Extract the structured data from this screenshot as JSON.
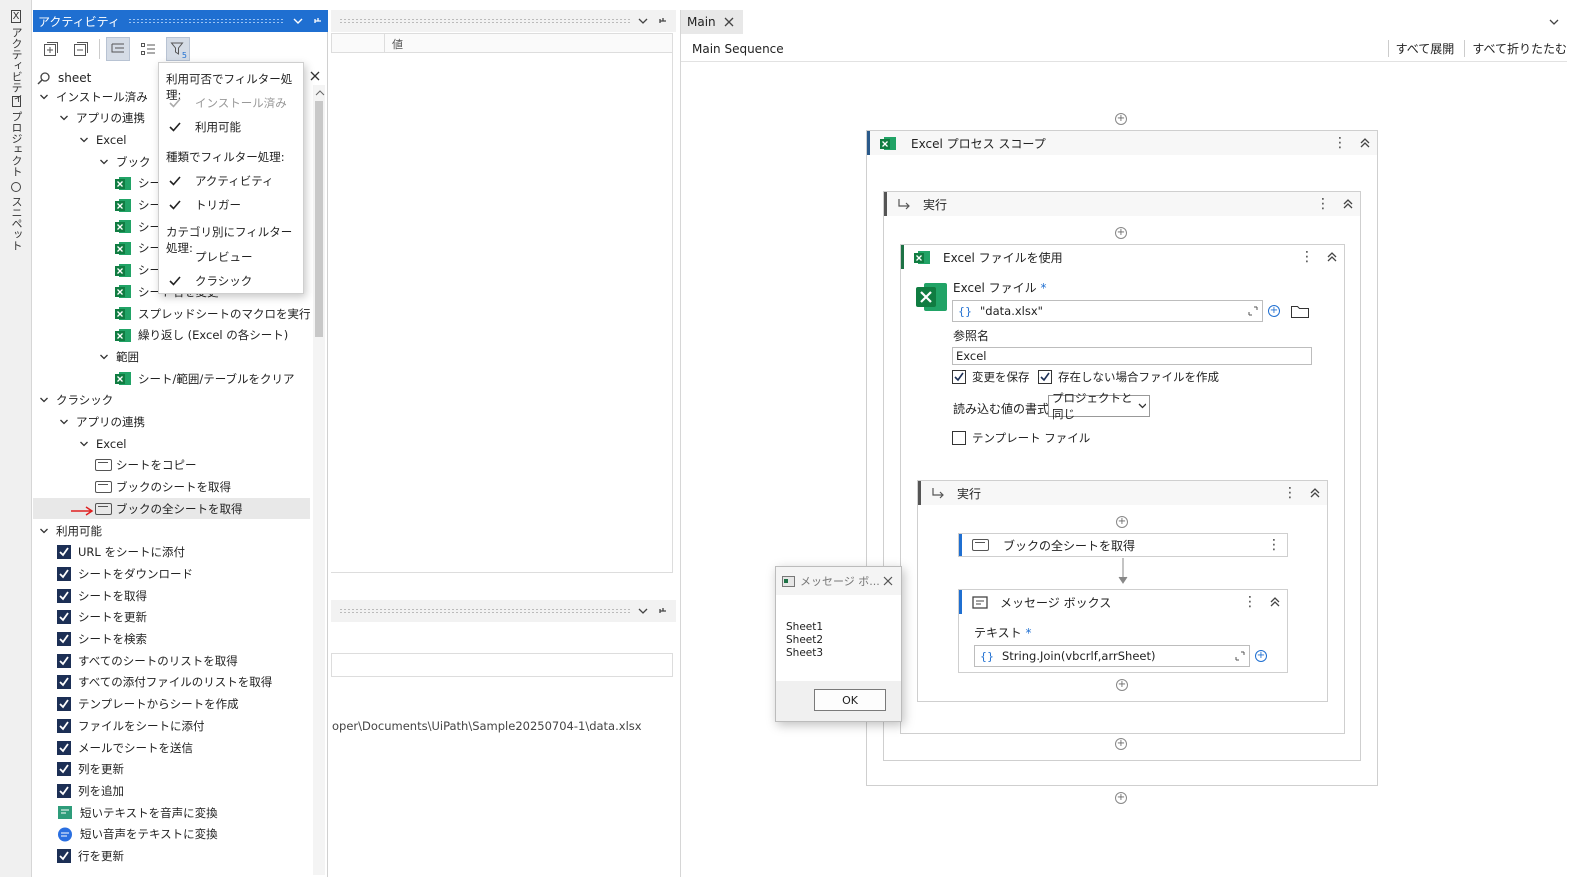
{
  "strip": {
    "tabs": [
      "アクティビティ",
      "プロジェクト",
      "スニペット"
    ]
  },
  "activities": {
    "title": "アクティビティ",
    "search_value": "sheet",
    "tree": [
      {
        "label": "インストール済み",
        "kind": "group"
      },
      {
        "label": "アプリの連携",
        "kind": "group"
      },
      {
        "label": "Excel",
        "kind": "group"
      },
      {
        "label": "ブック",
        "kind": "group"
      },
      {
        "label": "シートを…",
        "kind": "excel"
      },
      {
        "label": "シート…",
        "kind": "excel"
      },
      {
        "label": "シート…",
        "kind": "excel"
      },
      {
        "label": "シート…",
        "kind": "excel"
      },
      {
        "label": "シート…",
        "kind": "excel"
      },
      {
        "label": "シート名を変更",
        "kind": "excel"
      },
      {
        "label": "スプレッドシートのマクロを実行",
        "kind": "excel"
      },
      {
        "label": "繰り返し (Excel の各シート)",
        "kind": "excel"
      },
      {
        "label": "範囲",
        "kind": "group"
      },
      {
        "label": "シート/範囲/テーブルをクリア",
        "kind": "excel"
      },
      {
        "label": "クラシック",
        "kind": "group"
      },
      {
        "label": "アプリの連携",
        "kind": "group"
      },
      {
        "label": "Excel",
        "kind": "group"
      },
      {
        "label": "シートをコピー",
        "kind": "classic"
      },
      {
        "label": "ブックのシートを取得",
        "kind": "classic"
      },
      {
        "label": "ブックの全シートを取得",
        "kind": "classic"
      },
      {
        "label": "利用可能",
        "kind": "group"
      },
      {
        "label": "URL をシートに添付",
        "kind": "avail"
      },
      {
        "label": "シートをダウンロード",
        "kind": "avail"
      },
      {
        "label": "シートを取得",
        "kind": "avail"
      },
      {
        "label": "シートを更新",
        "kind": "avail"
      },
      {
        "label": "シートを検索",
        "kind": "avail"
      },
      {
        "label": "すべてのシートのリストを取得",
        "kind": "avail"
      },
      {
        "label": "すべての添付ファイルのリストを取得",
        "kind": "avail"
      },
      {
        "label": "テンプレートからシートを作成",
        "kind": "avail"
      },
      {
        "label": "ファイルをシートに添付",
        "kind": "avail"
      },
      {
        "label": "メールでシートを送信",
        "kind": "avail"
      },
      {
        "label": "列を更新",
        "kind": "avail"
      },
      {
        "label": "列を追加",
        "kind": "avail"
      },
      {
        "label": "短いテキストを音声に変換",
        "kind": "tts"
      },
      {
        "label": "短い音声をテキストに変換",
        "kind": "stt"
      },
      {
        "label": "行を更新",
        "kind": "avail"
      }
    ]
  },
  "filter_popup": {
    "header_availability": "利用可否でフィルター処理:",
    "installed": "インストール済み",
    "available": "利用可能",
    "header_type": "種類でフィルター処理:",
    "activity": "アクティビティ",
    "trigger": "トリガー",
    "header_category": "カテゴリ別にフィルター処理:",
    "preview": "プレビュー",
    "classic": "クラシック",
    "filter_badge": "5"
  },
  "properties": {
    "value_col": "値",
    "path_text": "oper\\Documents\\UiPath\\Sample20250704-1\\data.xlsx"
  },
  "designer": {
    "tab": "Main",
    "breadcrumb": "Main Sequence",
    "expand_all": "すべて展開",
    "collapse_all": "すべて折りたたむ",
    "scope_title": "Excel プロセス スコープ",
    "do1": "実行",
    "use_file_title": "Excel ファイルを使用",
    "excel_file_label": "Excel ファイル",
    "excel_file_value": "\"data.xlsx\"",
    "ref_name_label": "参照名",
    "ref_name_value": "Excel",
    "save_changes": "変更を保存",
    "create_if_missing": "存在しない場合ファイルを作成",
    "read_format_label": "読み込む値の書式",
    "read_format_value": "プロジェクトと同じ",
    "template_file": "テンプレート ファイル",
    "do2": "実行",
    "get_sheets_title": "ブックの全シートを取得",
    "msgbox_title": "メッセージ ボックス",
    "text_label": "テキスト",
    "text_value": "String.Join(vbcrlf,arrSheet)",
    "required_mark": "*"
  },
  "message_box": {
    "title": "メッセージ ボ...",
    "lines": [
      "Sheet1",
      "Sheet2",
      "Sheet3"
    ],
    "ok": "OK"
  },
  "colors": {
    "accent": "#1f6fd1",
    "excel_green": "#1d7245",
    "arrow_red": "#e02020",
    "check_navy": "#1c2f55"
  }
}
